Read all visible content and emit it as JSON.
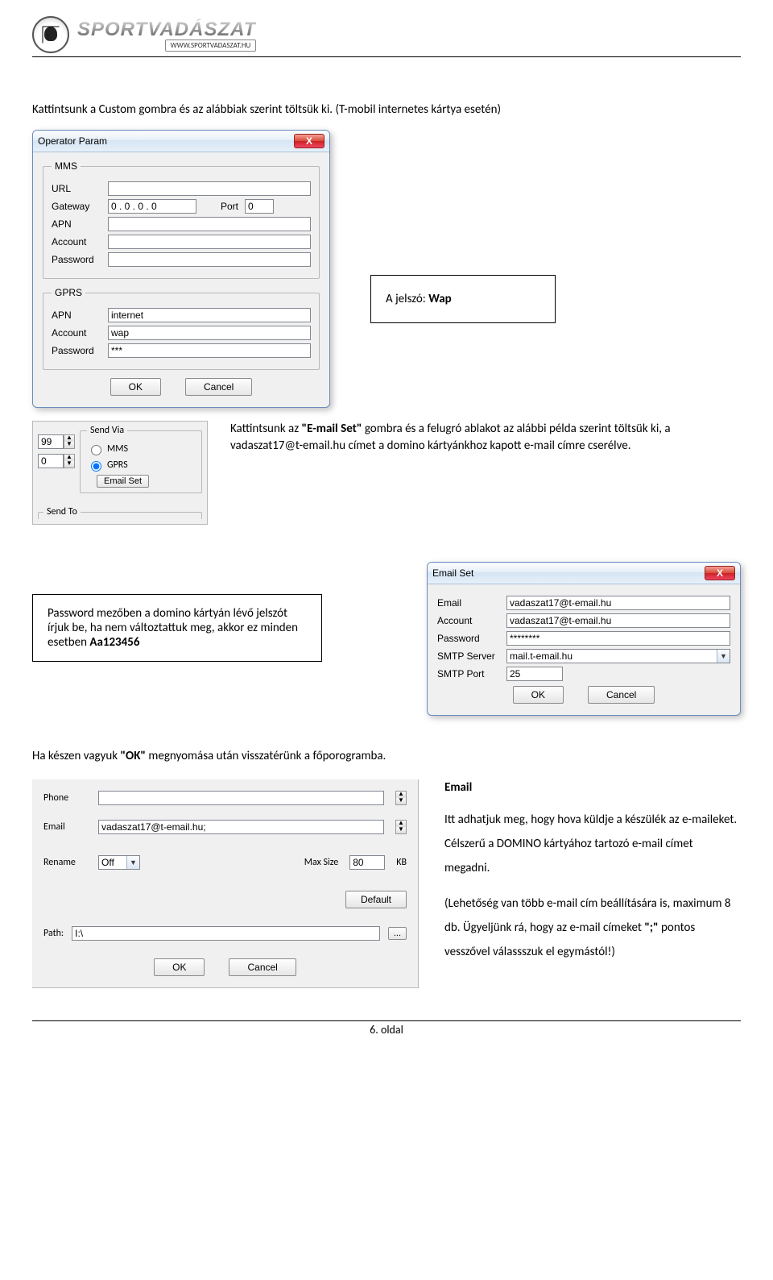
{
  "header": {
    "brand": "SPORTVADÁSZAT",
    "url": "WWW.SPORTVADASZAT.HU"
  },
  "intro": {
    "line1_a": "Kattintsunk a Custom gombra és az alábbiak szerint töltsük ki. ",
    "line1_b": "(T-mobil internetes kártya esetén)"
  },
  "operatorDialog": {
    "title": "Operator Param",
    "mms": {
      "legend": "MMS",
      "url": "URL",
      "gateway": "Gateway",
      "port": "Port",
      "apn": "APN",
      "account": "Account",
      "password": "Password",
      "gateway_val": "0 . 0 . 0 . 0",
      "port_val": "0"
    },
    "gprs": {
      "legend": "GPRS",
      "apn": "APN",
      "account": "Account",
      "password": "Password",
      "apn_val": "internet",
      "account_val": "wap",
      "password_val": "***"
    },
    "ok": "OK",
    "cancel": "Cancel"
  },
  "wapCallout": {
    "pre": "A jelszó: ",
    "val": "Wap"
  },
  "sendVia": {
    "left_top": "99",
    "left_bottom": "0",
    "legend": "Send Via",
    "mms": "MMS",
    "gprs": "GPRS",
    "btn": "Email Set",
    "sendTo": "Send To"
  },
  "emailSetPara": {
    "a": "Kattintsunk az ",
    "b": "\"E-mail Set\"",
    "c": " gombra és a felugró ablakot az alábbi példa szerint töltsük ki, a vadaszat17@t-email.hu címet a domino kártyánkhoz kapott e-mail címre cserélve."
  },
  "pwCallout": {
    "a": "Password mezőben a domino kártyán lévő jelszót írjuk be, ha nem változtattuk meg, akkor ez minden esetben ",
    "b": "Aa123456"
  },
  "emailDialog": {
    "title": "Email Set",
    "email": "Email",
    "account": "Account",
    "password": "Password",
    "smtp": "SMTP Server",
    "port": "SMTP Port",
    "email_val": "vadaszat17@t-email.hu",
    "account_val": "vadaszat17@t-email.hu",
    "password_val": "********",
    "smtp_val": "mail.t-email.hu",
    "port_val": "25",
    "ok": "OK",
    "cancel": "Cancel"
  },
  "afterOk": {
    "a": "Ha készen vagyuk ",
    "b": "\"OK\"",
    "c": " megnyomása után visszatérünk a főporogramba."
  },
  "settingsFragment": {
    "phone": "Phone",
    "email": "Email",
    "rename": "Rename",
    "maxsize": "Max Size",
    "kb": "KB",
    "email_val": "vadaszat17@t-email.hu;",
    "rename_val": "Off",
    "maxsize_val": "80",
    "default": "Default",
    "path": "Path:",
    "path_val": "I:\\",
    "ok": "OK",
    "cancel": "Cancel"
  },
  "emailExplain": {
    "title": "Email",
    "p1": "Itt adhatjuk meg, hogy hova küldje a készülék az e-maileket. Célszerű a DOMINO kártyához tartozó e-mail címet megadni.",
    "p2_a": "(Lehetőség van több e-mail cím beállítására is, maximum 8 db. Ügyeljünk rá, hogy az e-mail címeket ",
    "p2_b": "\";\"",
    "p2_c": " pontos vesszővel válassszuk el egymástól!)"
  },
  "footer": "6. oldal"
}
